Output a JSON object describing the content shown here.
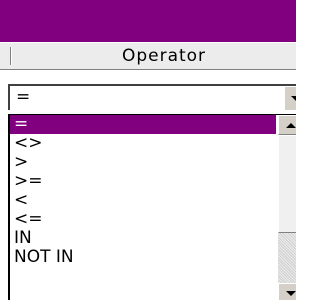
{
  "window": {
    "title": ""
  },
  "header": {
    "column_label": "Operator"
  },
  "combo": {
    "value": "="
  },
  "operators": {
    "items": [
      {
        "label": "=",
        "selected": true
      },
      {
        "label": "<>",
        "selected": false
      },
      {
        "label": ">",
        "selected": false
      },
      {
        "label": ">=",
        "selected": false
      },
      {
        "label": "<",
        "selected": false
      },
      {
        "label": "<=",
        "selected": false
      },
      {
        "label": "IN",
        "selected": false
      },
      {
        "label": "NOT IN",
        "selected": false
      }
    ]
  },
  "colors": {
    "title_bar": "#800080",
    "selection": "#800080"
  }
}
